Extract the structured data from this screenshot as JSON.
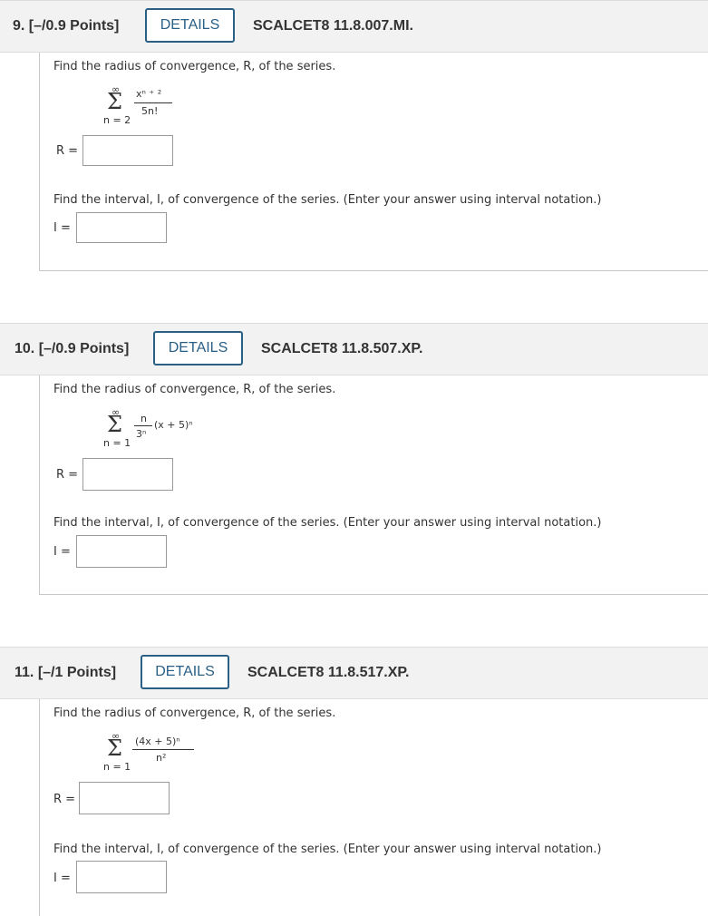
{
  "questions": [
    {
      "number": "9.",
      "points": "[–/0.9 Points]",
      "details_label": "DETAILS",
      "code": "SCALCET8 11.8.007.MI.",
      "radius_prompt": "Find the radius of convergence, R, of the series.",
      "series": {
        "upper": "∞",
        "sigma": "Σ",
        "lower": "n = 2",
        "numerator": "xⁿ ⁺ ²",
        "denominator": "5n!",
        "tail": ""
      },
      "radius_label": "R =",
      "radius_value": "",
      "interval_prompt": "Find the interval, I, of convergence of the series. (Enter your answer using interval notation.)",
      "interval_label": "I =",
      "interval_value": ""
    },
    {
      "number": "10.",
      "points": "[–/0.9 Points]",
      "details_label": "DETAILS",
      "code": "SCALCET8 11.8.507.XP.",
      "radius_prompt": "Find the radius of convergence, R, of the series.",
      "series": {
        "upper": "∞",
        "sigma": "Σ",
        "lower": "n = 1",
        "numerator": "n",
        "denominator": "3ⁿ",
        "tail": "(x + 5)ⁿ"
      },
      "radius_label": "R =",
      "radius_value": "",
      "interval_prompt": "Find the interval, I, of convergence of the series. (Enter your answer using interval notation.)",
      "interval_label": "I =",
      "interval_value": ""
    },
    {
      "number": "11.",
      "points": "[–/1 Points]",
      "details_label": "DETAILS",
      "code": "SCALCET8 11.8.517.XP.",
      "radius_prompt": "Find the radius of convergence, R, of the series.",
      "series": {
        "upper": "∞",
        "sigma": "Σ",
        "lower": "n = 1",
        "numerator": "(4x + 5)ⁿ",
        "denominator": "n²",
        "tail": ""
      },
      "radius_label": "R =",
      "radius_value": "",
      "interval_prompt": "Find the interval, I, of convergence of the series. (Enter your answer using interval notation.)",
      "interval_label": "I =",
      "interval_value": ""
    }
  ],
  "colors": {
    "accent": "#2a5f86",
    "header_bg": "#f2f2f2",
    "text": "#333333"
  }
}
